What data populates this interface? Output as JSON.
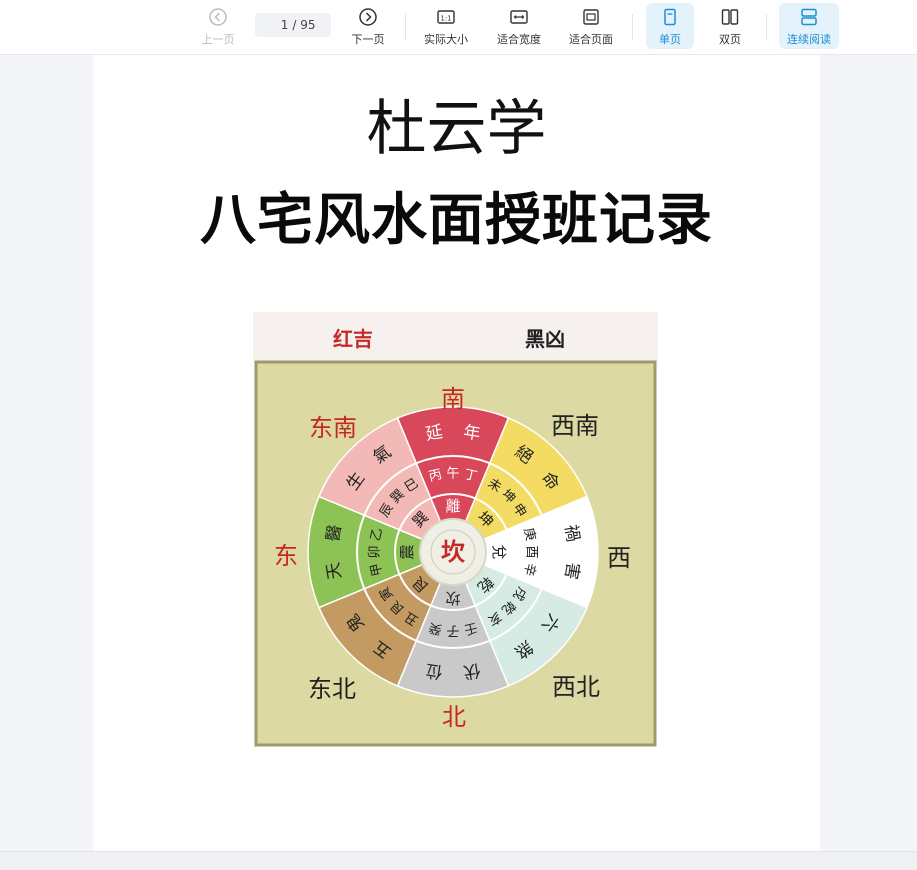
{
  "toolbar": {
    "prev_label": "上一页",
    "next_label": "下一页",
    "page_current": "1",
    "page_total": "/ 95",
    "actual_size_label": "实际大小",
    "fit_width_label": "适合宽度",
    "fit_page_label": "适合页面",
    "single_page_label": "单页",
    "double_page_label": "双页",
    "continuous_label": "连续阅读"
  },
  "document": {
    "title": "杜云学",
    "subtitle": "八宅风水面授班记录"
  },
  "figure": {
    "legend_auspicious": "红吉",
    "legend_inauspicious": "黑凶",
    "directions": {
      "south": "南",
      "southwest": "西南",
      "west": "西",
      "northwest": "西北",
      "north": "北",
      "northeast": "东北",
      "east": "东",
      "southeast": "东南"
    },
    "center": "坎",
    "sectors": [
      {
        "star": "延年",
        "stems": "丙午丁",
        "trigram": "離",
        "color": "#d9475a",
        "text_color": "#ffffff"
      },
      {
        "star": "絕命",
        "stems": "未坤申",
        "trigram": "坤",
        "color": "#f4dc64",
        "text_color": "#222222"
      },
      {
        "star": "禍害",
        "stems": "庚酉辛",
        "trigram": "兌",
        "color": "#ffffff",
        "text_color": "#222222"
      },
      {
        "star": "六煞",
        "stems": "戌乾亥",
        "trigram": "乾",
        "color": "#d5ebe3",
        "text_color": "#222222"
      },
      {
        "star": "伏位",
        "stems": "壬子癸",
        "trigram": "坎",
        "color": "#c9c9c9",
        "text_color": "#222222"
      },
      {
        "star": "五鬼",
        "stems": "丑艮寅",
        "trigram": "艮",
        "color": "#c49a63",
        "text_color": "#222222"
      },
      {
        "star": "天醫",
        "stems": "甲卯乙",
        "trigram": "震",
        "color": "#8dc255",
        "text_color": "#222222"
      },
      {
        "star": "生氣",
        "stems": "辰巽巳",
        "trigram": "巽",
        "color": "#f2b9b6",
        "text_color": "#222222"
      }
    ],
    "colors": {
      "background": "#dcd9a2",
      "direction_red": "#c62828",
      "direction_black": "#222222"
    }
  }
}
